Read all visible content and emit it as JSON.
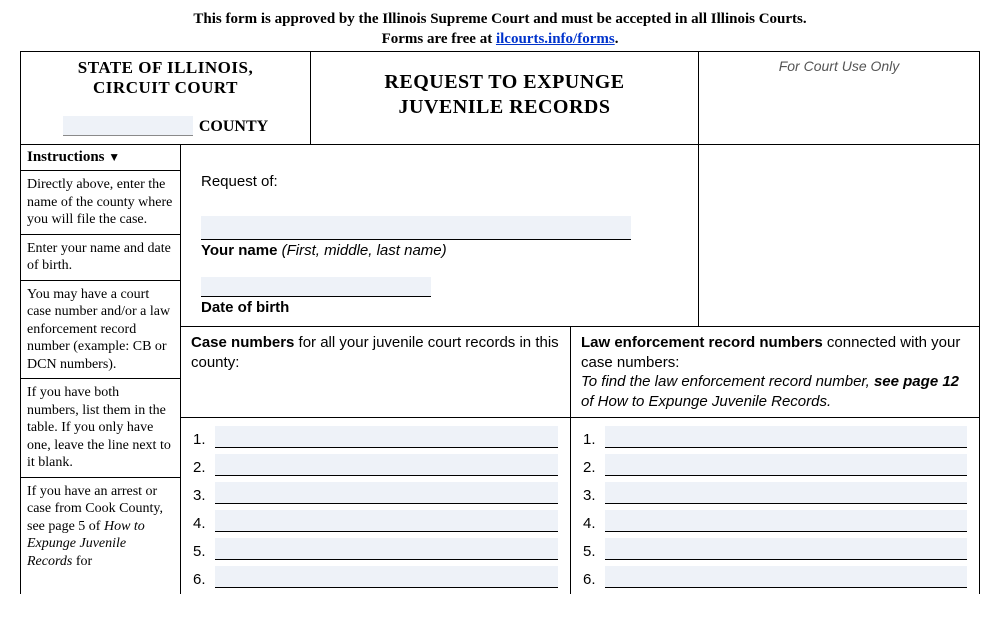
{
  "approval": {
    "line1": "This form is approved by the Illinois Supreme Court and must be accepted in all Illinois Courts.",
    "line2_prefix": "Forms are free at ",
    "link_text": "ilcourts.info/forms",
    "line2_suffix": "."
  },
  "header": {
    "state_line1": "STATE OF ILLINOIS,",
    "state_line2": "CIRCUIT COURT",
    "county_label": "COUNTY",
    "title_line1": "REQUEST TO EXPUNGE",
    "title_line2": "JUVENILE RECORDS",
    "court_use": "For Court Use Only"
  },
  "instructions": {
    "heading": "Instructions",
    "items": [
      "Directly above, enter the name of the county where you will file the case.",
      "Enter your name and date of birth.",
      "You may have a court case number and/or a law enforcement record number (example: CB or DCN numbers).",
      "If you have both numbers, list them in the table. If you only have one, leave the line next to it blank.",
      "If you have an arrest or case from Cook County, see page 5 of How to Expunge Juvenile Records for"
    ]
  },
  "request": {
    "of_label": "Request of:",
    "name_label_bold": "Your name",
    "name_label_ital": "(First, middle, last name)",
    "dob_label": "Date of birth"
  },
  "cases": {
    "left_bold": "Case numbers",
    "left_rest": " for all your juvenile court records in this county:",
    "right_bold": "Law enforcement record numbers",
    "right_rest": " connected with your case numbers:",
    "right_hint_prefix": "To find the law enforcement record number, ",
    "right_hint_bold": "see page 12",
    "right_hint_suffix": " of How to Expunge Juvenile Records.",
    "numbers": [
      "1.",
      "2.",
      "3.",
      "4.",
      "5.",
      "6."
    ]
  }
}
